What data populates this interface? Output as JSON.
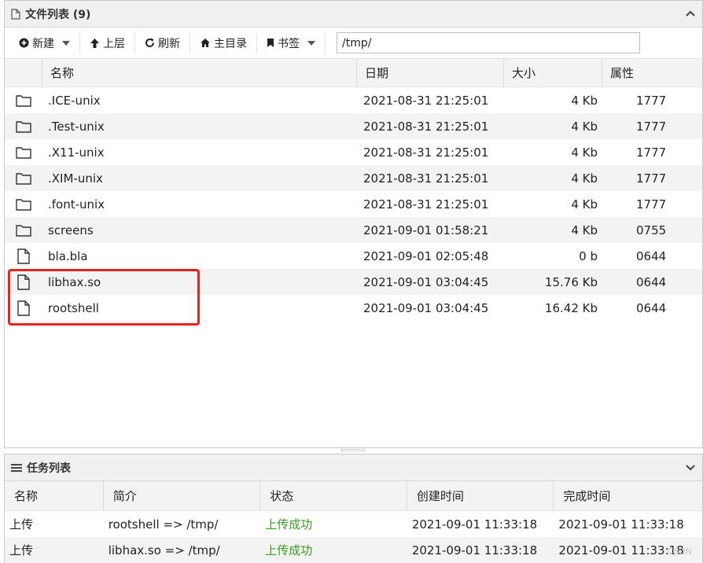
{
  "file_panel": {
    "title": "文件列表 (9)",
    "toolbar": {
      "new_label": "新建",
      "up_label": "上层",
      "refresh_label": "刷新",
      "home_label": "主目录",
      "bookmark_label": "书签",
      "path_value": "/tmp/"
    },
    "columns": {
      "name": "名称",
      "date": "日期",
      "size": "大小",
      "attr": "属性"
    },
    "files": [
      {
        "type": "folder",
        "name": ".ICE-unix",
        "date": "2021-08-31 21:25:01",
        "size": "4 Kb",
        "attr": "1777"
      },
      {
        "type": "folder",
        "name": ".Test-unix",
        "date": "2021-08-31 21:25:01",
        "size": "4 Kb",
        "attr": "1777"
      },
      {
        "type": "folder",
        "name": ".X11-unix",
        "date": "2021-08-31 21:25:01",
        "size": "4 Kb",
        "attr": "1777"
      },
      {
        "type": "folder",
        "name": ".XIM-unix",
        "date": "2021-08-31 21:25:01",
        "size": "4 Kb",
        "attr": "1777"
      },
      {
        "type": "folder",
        "name": ".font-unix",
        "date": "2021-08-31 21:25:01",
        "size": "4 Kb",
        "attr": "1777"
      },
      {
        "type": "folder",
        "name": "screens",
        "date": "2021-09-01 01:58:21",
        "size": "4 Kb",
        "attr": "0755"
      },
      {
        "type": "file",
        "name": "bla.bla",
        "date": "2021-09-01 02:05:48",
        "size": "0 b",
        "attr": "0644"
      },
      {
        "type": "file",
        "name": "libhax.so",
        "date": "2021-09-01 03:04:45",
        "size": "15.76 Kb",
        "attr": "0644"
      },
      {
        "type": "file",
        "name": "rootshell",
        "date": "2021-09-01 03:04:45",
        "size": "16.42 Kb",
        "attr": "0644"
      }
    ],
    "highlight_color": "#e8231d"
  },
  "task_panel": {
    "title": "任务列表",
    "columns": {
      "type": "名称",
      "desc": "简介",
      "status": "状态",
      "created": "创建时间",
      "done": "完成时间"
    },
    "tasks": [
      {
        "type": "上传",
        "desc": "rootshell => /tmp/",
        "status": "上传成功",
        "created": "2021-09-01 11:33:18",
        "done": "2021-09-01 11:33:18"
      },
      {
        "type": "上传",
        "desc": "libhax.so => /tmp/",
        "status": "上传成功",
        "created": "2021-09-01 11:33:18",
        "done": "2021-09-01 11:33:18"
      }
    ],
    "success_color": "#3a9d23"
  }
}
